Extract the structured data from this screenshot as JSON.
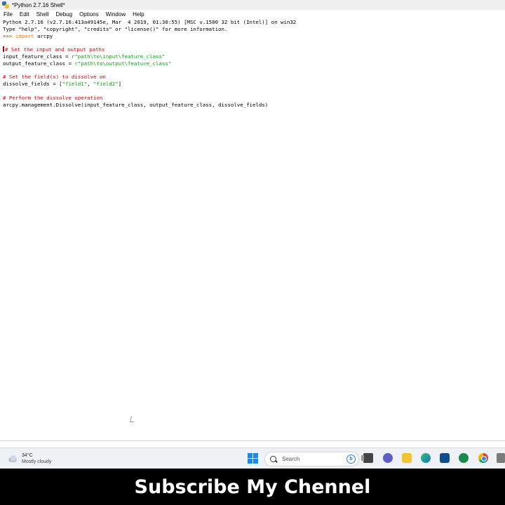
{
  "window": {
    "title": "*Python 2.7.16 Shell*"
  },
  "menu": [
    "File",
    "Edit",
    "Shell",
    "Debug",
    "Options",
    "Window",
    "Help"
  ],
  "shell": {
    "banner_line1": "Python 2.7.16 (v2.7.16:413a49145e, Mar  4 2019, 01:30:55) [MSC v.1500 32 bit (Intel)] on win32",
    "banner_line2": "Type \"help\", \"copyright\", \"credits\" or \"license()\" for more information.",
    "prompt": ">>> ",
    "import_kw": "import",
    "import_mod": " arcpy",
    "comment1": "# Set the input and output paths",
    "in_var": "input_feature_class = ",
    "in_val": "r\"path\\to\\input\\feature_class\"",
    "out_var": "output_feature_class = ",
    "out_val": "r\"path\\to\\output\\feature_class\"",
    "comment2": "# Set the field(s) to dissolve on",
    "fields_var": "dissolve_fields = [",
    "field1": "\"field1\"",
    "sep": ", ",
    "field2": "\"field2\"",
    "fields_end": "]",
    "comment3": "# Perform the dissolve operation",
    "call": "arcpy.management.Dissolve(input_feature_class, output_feature_class, dissolve_fields)"
  },
  "taskbar": {
    "weather_temp": "34°C",
    "weather_cond": "Mostly cloudy",
    "search_placeholder": "Search",
    "bing_label": "b"
  },
  "colors": {
    "keyword": "#ff7700",
    "string": "#00aa00",
    "comment": "#dd0000"
  },
  "banner": {
    "text": "Subscribe My Chennel"
  }
}
